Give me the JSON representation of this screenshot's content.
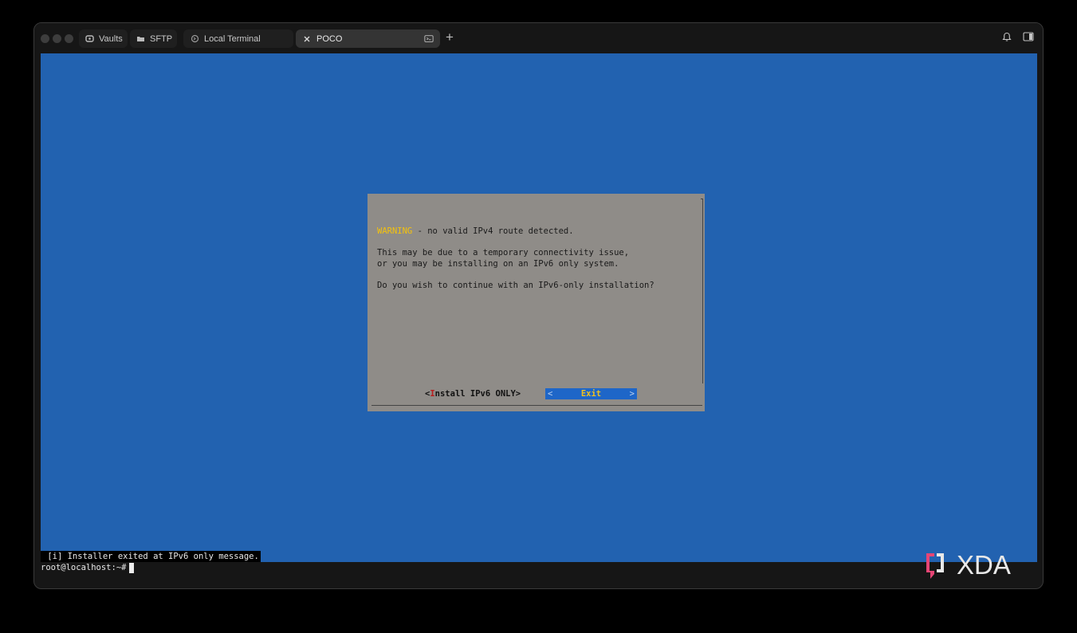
{
  "tabs": [
    {
      "label": "Vaults",
      "icon": "vault-icon"
    },
    {
      "label": "SFTP",
      "icon": "folder-icon"
    },
    {
      "label": "Local Terminal",
      "icon": "terminal-icon"
    },
    {
      "label": "POCO",
      "icon": "close-icon",
      "active": true
    }
  ],
  "dialog": {
    "warning_word": "WARNING",
    "warning_rest": " - no valid IPv4 route detected.",
    "line1": "This may be due to a temporary connectivity issue,",
    "line2": "or you may be installing on an IPv6 only system.",
    "line3": "Do you wish to continue with an IPv6-only installation?",
    "install_open": "<",
    "install_hot": "I",
    "install_rest": "nstall IPv6 ONLY>",
    "exit_left": "<",
    "exit_label": "Exit",
    "exit_right": ">"
  },
  "terminal": {
    "status_message": " [i] Installer exited at IPv6 only message.",
    "prompt": "root@localhost:~#"
  },
  "watermark": {
    "text": "XDA"
  },
  "colors": {
    "terminal_bg": "#2262b0",
    "dialog_bg": "#8f8c88",
    "warning": "#f4c20d",
    "selected_button": "#1e66c8"
  }
}
